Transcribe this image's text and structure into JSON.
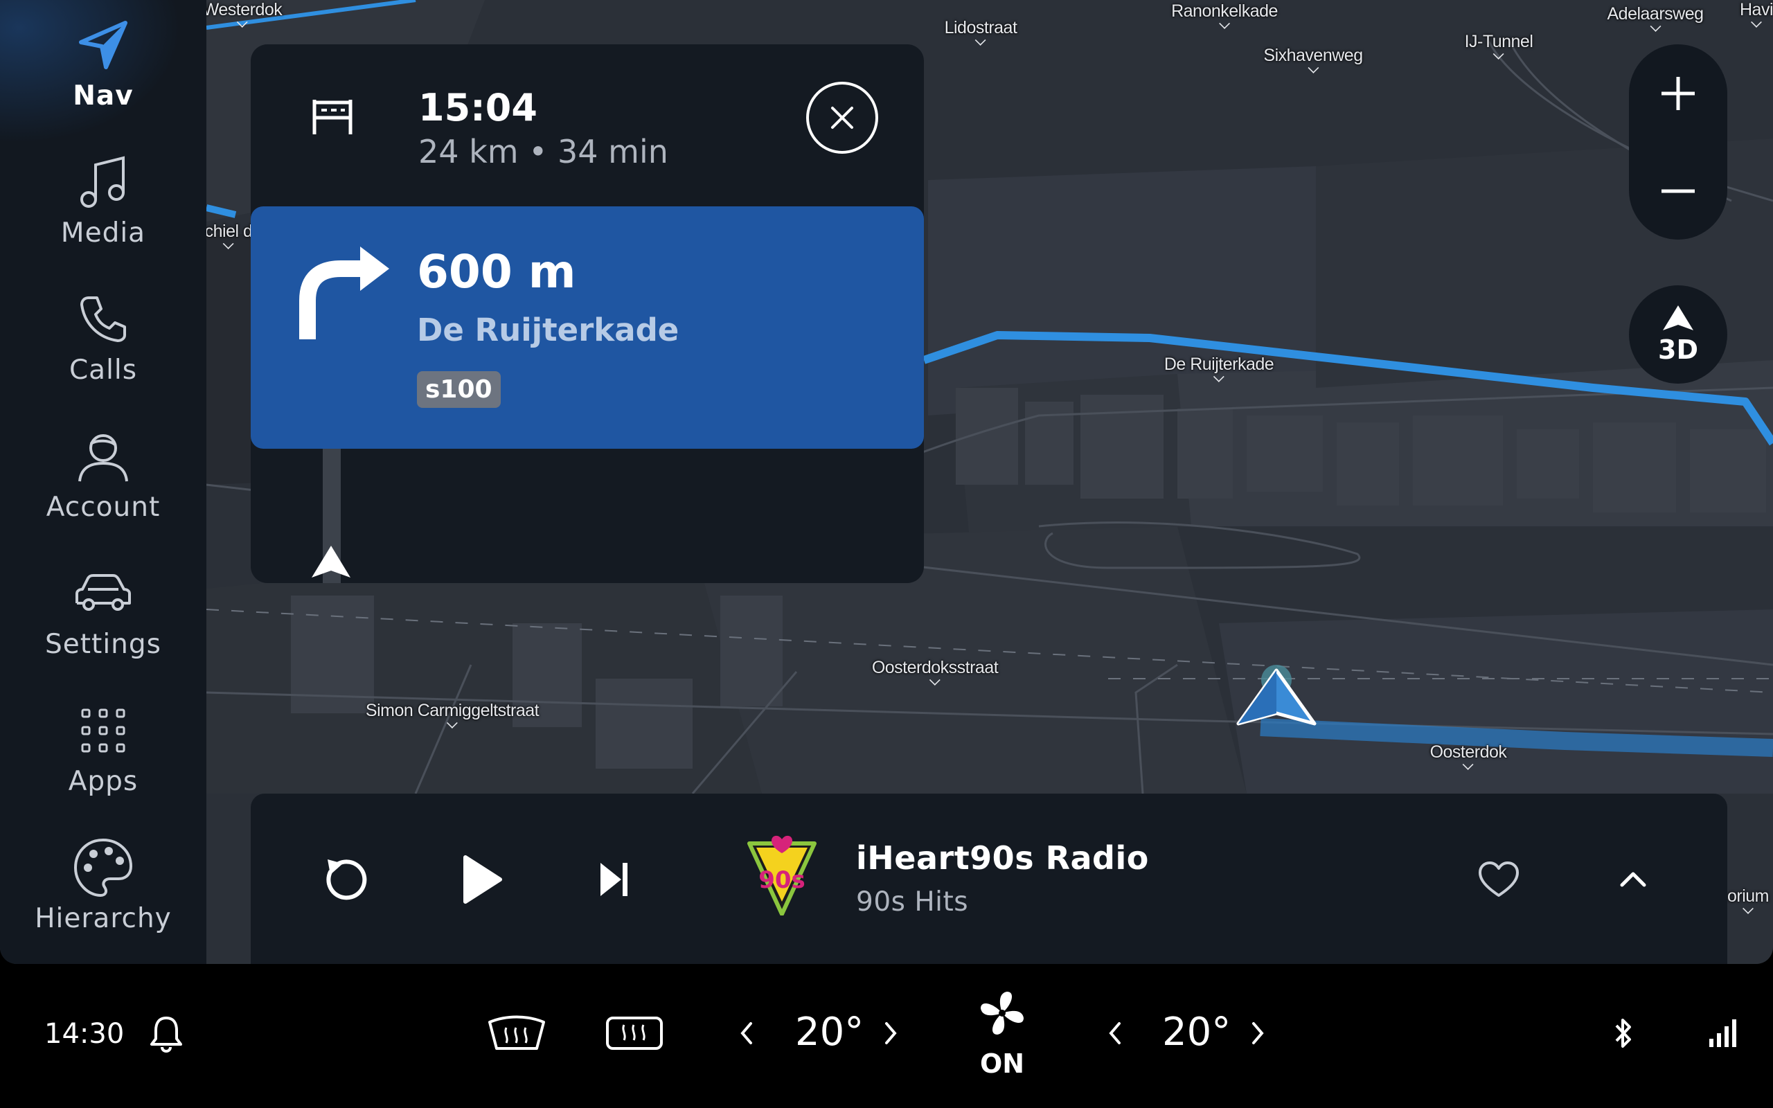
{
  "sidebar": {
    "items": [
      {
        "label": "Nav",
        "icon": "navigation-arrow-icon",
        "active": true
      },
      {
        "label": "Media",
        "icon": "music-note-icon"
      },
      {
        "label": "Calls",
        "icon": "phone-icon"
      },
      {
        "label": "Account",
        "icon": "person-icon"
      },
      {
        "label": "Settings",
        "icon": "car-icon"
      },
      {
        "label": "Apps",
        "icon": "grid-icon"
      },
      {
        "label": "Hierarchy",
        "icon": "palette-icon"
      }
    ]
  },
  "trip": {
    "arrival_time": "15:04",
    "detail": "24 km • 34 min"
  },
  "maneuver": {
    "distance": "600 m",
    "street": "De Ruijterkade",
    "road_badge": "s100",
    "icon": "turn-right-arrow-icon"
  },
  "map": {
    "labels": [
      "Westerdok",
      "Lidostraat",
      "Ranonkelkade",
      "Sixhavenweg",
      "IJ-Tunnel",
      "Adelaarsweg",
      "chiel d",
      "De Ruijterkade",
      "Oosterdoksstraat",
      "Simon Carmiggeltstraat",
      "Oosterdok",
      "Havi",
      "orium"
    ],
    "view_mode": "3D",
    "route_color": "#2f8fe0"
  },
  "media": {
    "station": "iHeart90s Radio",
    "subtitle": "90s Hits",
    "logo_text": "90s"
  },
  "system": {
    "clock": "14:30",
    "temp_left": "20°",
    "temp_right": "20°",
    "fan_state": "ON"
  },
  "colors": {
    "maneuver_bg": "#1f56a2",
    "panel_bg": "#141a22",
    "rail_bg": "#121820"
  }
}
